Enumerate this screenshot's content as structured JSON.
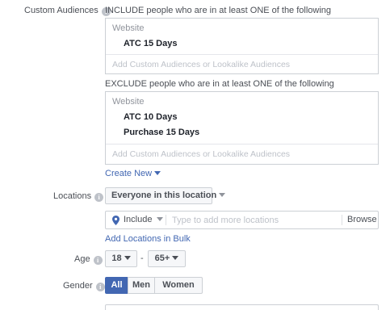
{
  "custom_audiences": {
    "label": "Custom Audiences",
    "include_heading": "INCLUDE people who are in at least ONE of the following",
    "include_category": "Website",
    "include_items": [
      "ATC 15 Days"
    ],
    "include_placeholder": "Add Custom Audiences or Lookalike Audiences",
    "exclude_heading": "EXCLUDE people who are in at least ONE of the following",
    "exclude_category": "Website",
    "exclude_items": [
      "ATC 10 Days",
      "Purchase 15 Days"
    ],
    "exclude_placeholder": "Add Custom Audiences or Lookalike Audiences",
    "create_new": "Create New"
  },
  "locations": {
    "label": "Locations",
    "dropdown_value": "Everyone in this location",
    "include_value": "Include",
    "placeholder": "Type to add more locations",
    "browse": "Browse",
    "bulk_link": "Add Locations in Bulk"
  },
  "age": {
    "label": "Age",
    "min": "18",
    "separator": "-",
    "max": "65+"
  },
  "gender": {
    "label": "Gender",
    "options": [
      "All",
      "Men",
      "Women"
    ],
    "selected": "All"
  },
  "icons": {
    "info": "info-icon",
    "pin": "location-pin-icon",
    "caret": "caret-down-icon"
  },
  "colors": {
    "accent": "#4267b2",
    "border": "#ccd0d5",
    "muted": "#90949c"
  }
}
